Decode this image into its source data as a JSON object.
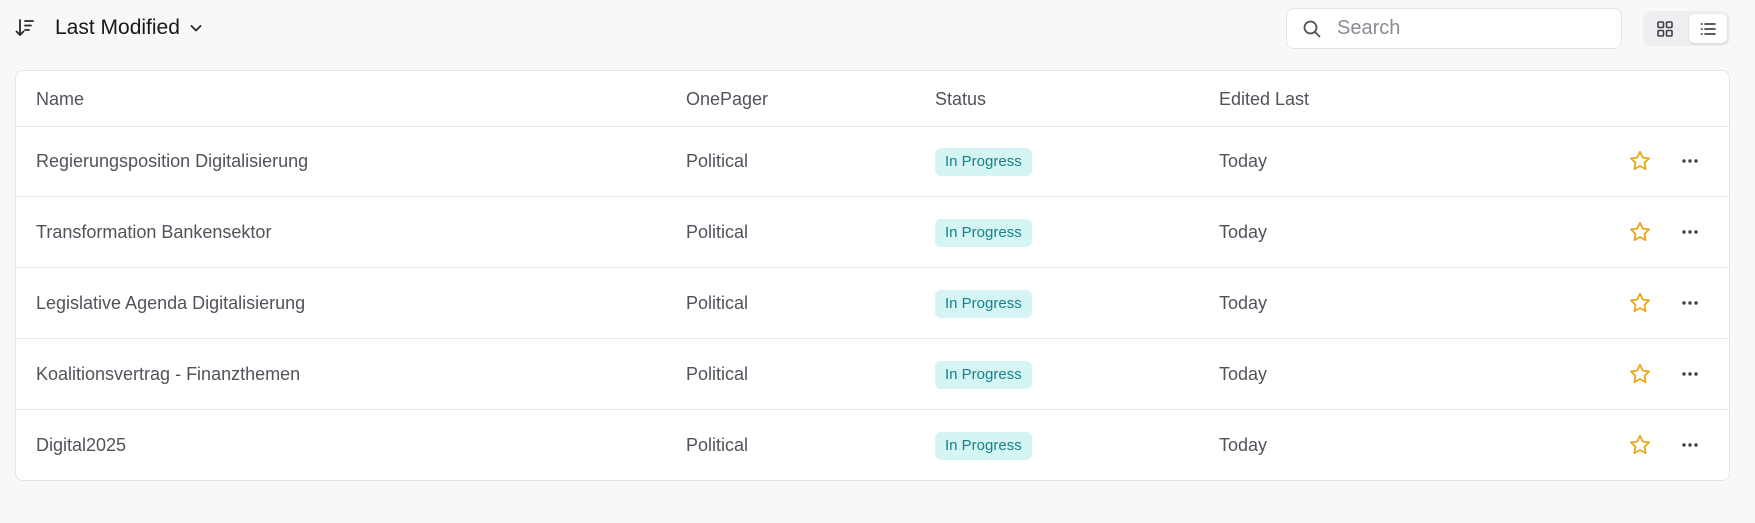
{
  "toolbar": {
    "sort_icon": "sort-descending-icon",
    "sort_label": "Last Modified",
    "search": {
      "placeholder": "Search",
      "value": ""
    },
    "view_toggle": {
      "grid_icon": "grid-view-icon",
      "list_icon": "list-view-icon",
      "active": "list"
    }
  },
  "table": {
    "columns": [
      "Name",
      "OnePager",
      "Status",
      "Edited Last"
    ],
    "rows": [
      {
        "name": "Regierungsposition Digitalisierung",
        "onepager": "Political",
        "status": "In Progress",
        "edited": "Today"
      },
      {
        "name": "Transformation Bankensektor",
        "onepager": "Political",
        "status": "In Progress",
        "edited": "Today"
      },
      {
        "name": "Legislative Agenda Digitalisierung",
        "onepager": "Political",
        "status": "In Progress",
        "edited": "Today"
      },
      {
        "name": "Koalitionsvertrag - Finanzthemen",
        "onepager": "Political",
        "status": "In Progress",
        "edited": "Today"
      },
      {
        "name": "Digital2025",
        "onepager": "Political",
        "status": "In Progress",
        "edited": "Today"
      }
    ],
    "row_icons": {
      "favorite": "star-icon",
      "more": "more-horizontal-icon"
    }
  },
  "colors": {
    "background": "#f8f8f9",
    "status_badge_bg": "#d5f4f4",
    "status_badge_text": "#14838a",
    "star": "#e8a817"
  }
}
